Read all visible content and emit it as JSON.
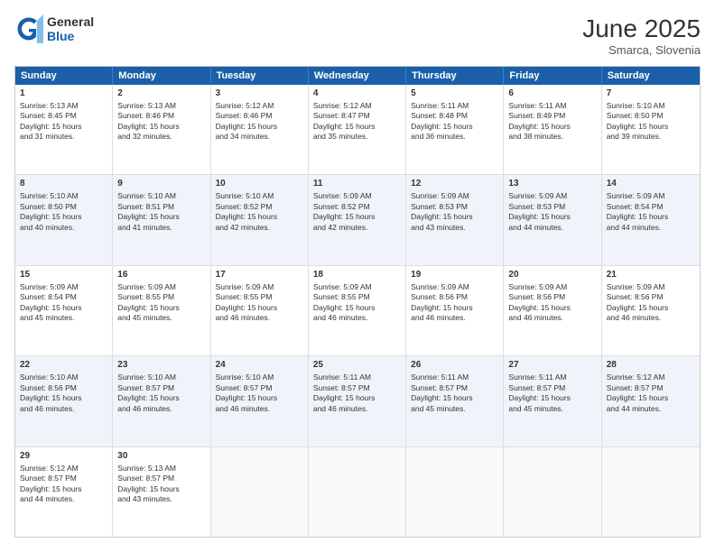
{
  "header": {
    "logo_general": "General",
    "logo_blue": "Blue",
    "month_title": "June 2025",
    "location": "Smarca, Slovenia"
  },
  "weekdays": [
    "Sunday",
    "Monday",
    "Tuesday",
    "Wednesday",
    "Thursday",
    "Friday",
    "Saturday"
  ],
  "rows": [
    {
      "alt": false,
      "cells": [
        {
          "day": "1",
          "lines": [
            "Sunrise: 5:13 AM",
            "Sunset: 8:45 PM",
            "Daylight: 15 hours",
            "and 31 minutes."
          ]
        },
        {
          "day": "2",
          "lines": [
            "Sunrise: 5:13 AM",
            "Sunset: 8:46 PM",
            "Daylight: 15 hours",
            "and 32 minutes."
          ]
        },
        {
          "day": "3",
          "lines": [
            "Sunrise: 5:12 AM",
            "Sunset: 8:46 PM",
            "Daylight: 15 hours",
            "and 34 minutes."
          ]
        },
        {
          "day": "4",
          "lines": [
            "Sunrise: 5:12 AM",
            "Sunset: 8:47 PM",
            "Daylight: 15 hours",
            "and 35 minutes."
          ]
        },
        {
          "day": "5",
          "lines": [
            "Sunrise: 5:11 AM",
            "Sunset: 8:48 PM",
            "Daylight: 15 hours",
            "and 36 minutes."
          ]
        },
        {
          "day": "6",
          "lines": [
            "Sunrise: 5:11 AM",
            "Sunset: 8:49 PM",
            "Daylight: 15 hours",
            "and 38 minutes."
          ]
        },
        {
          "day": "7",
          "lines": [
            "Sunrise: 5:10 AM",
            "Sunset: 8:50 PM",
            "Daylight: 15 hours",
            "and 39 minutes."
          ]
        }
      ]
    },
    {
      "alt": true,
      "cells": [
        {
          "day": "8",
          "lines": [
            "Sunrise: 5:10 AM",
            "Sunset: 8:50 PM",
            "Daylight: 15 hours",
            "and 40 minutes."
          ]
        },
        {
          "day": "9",
          "lines": [
            "Sunrise: 5:10 AM",
            "Sunset: 8:51 PM",
            "Daylight: 15 hours",
            "and 41 minutes."
          ]
        },
        {
          "day": "10",
          "lines": [
            "Sunrise: 5:10 AM",
            "Sunset: 8:52 PM",
            "Daylight: 15 hours",
            "and 42 minutes."
          ]
        },
        {
          "day": "11",
          "lines": [
            "Sunrise: 5:09 AM",
            "Sunset: 8:52 PM",
            "Daylight: 15 hours",
            "and 42 minutes."
          ]
        },
        {
          "day": "12",
          "lines": [
            "Sunrise: 5:09 AM",
            "Sunset: 8:53 PM",
            "Daylight: 15 hours",
            "and 43 minutes."
          ]
        },
        {
          "day": "13",
          "lines": [
            "Sunrise: 5:09 AM",
            "Sunset: 8:53 PM",
            "Daylight: 15 hours",
            "and 44 minutes."
          ]
        },
        {
          "day": "14",
          "lines": [
            "Sunrise: 5:09 AM",
            "Sunset: 8:54 PM",
            "Daylight: 15 hours",
            "and 44 minutes."
          ]
        }
      ]
    },
    {
      "alt": false,
      "cells": [
        {
          "day": "15",
          "lines": [
            "Sunrise: 5:09 AM",
            "Sunset: 8:54 PM",
            "Daylight: 15 hours",
            "and 45 minutes."
          ]
        },
        {
          "day": "16",
          "lines": [
            "Sunrise: 5:09 AM",
            "Sunset: 8:55 PM",
            "Daylight: 15 hours",
            "and 45 minutes."
          ]
        },
        {
          "day": "17",
          "lines": [
            "Sunrise: 5:09 AM",
            "Sunset: 8:55 PM",
            "Daylight: 15 hours",
            "and 46 minutes."
          ]
        },
        {
          "day": "18",
          "lines": [
            "Sunrise: 5:09 AM",
            "Sunset: 8:55 PM",
            "Daylight: 15 hours",
            "and 46 minutes."
          ]
        },
        {
          "day": "19",
          "lines": [
            "Sunrise: 5:09 AM",
            "Sunset: 8:56 PM",
            "Daylight: 15 hours",
            "and 46 minutes."
          ]
        },
        {
          "day": "20",
          "lines": [
            "Sunrise: 5:09 AM",
            "Sunset: 8:56 PM",
            "Daylight: 15 hours",
            "and 46 minutes."
          ]
        },
        {
          "day": "21",
          "lines": [
            "Sunrise: 5:09 AM",
            "Sunset: 8:56 PM",
            "Daylight: 15 hours",
            "and 46 minutes."
          ]
        }
      ]
    },
    {
      "alt": true,
      "cells": [
        {
          "day": "22",
          "lines": [
            "Sunrise: 5:10 AM",
            "Sunset: 8:56 PM",
            "Daylight: 15 hours",
            "and 46 minutes."
          ]
        },
        {
          "day": "23",
          "lines": [
            "Sunrise: 5:10 AM",
            "Sunset: 8:57 PM",
            "Daylight: 15 hours",
            "and 46 minutes."
          ]
        },
        {
          "day": "24",
          "lines": [
            "Sunrise: 5:10 AM",
            "Sunset: 8:57 PM",
            "Daylight: 15 hours",
            "and 46 minutes."
          ]
        },
        {
          "day": "25",
          "lines": [
            "Sunrise: 5:11 AM",
            "Sunset: 8:57 PM",
            "Daylight: 15 hours",
            "and 46 minutes."
          ]
        },
        {
          "day": "26",
          "lines": [
            "Sunrise: 5:11 AM",
            "Sunset: 8:57 PM",
            "Daylight: 15 hours",
            "and 45 minutes."
          ]
        },
        {
          "day": "27",
          "lines": [
            "Sunrise: 5:11 AM",
            "Sunset: 8:57 PM",
            "Daylight: 15 hours",
            "and 45 minutes."
          ]
        },
        {
          "day": "28",
          "lines": [
            "Sunrise: 5:12 AM",
            "Sunset: 8:57 PM",
            "Daylight: 15 hours",
            "and 44 minutes."
          ]
        }
      ]
    },
    {
      "alt": false,
      "cells": [
        {
          "day": "29",
          "lines": [
            "Sunrise: 5:12 AM",
            "Sunset: 8:57 PM",
            "Daylight: 15 hours",
            "and 44 minutes."
          ]
        },
        {
          "day": "30",
          "lines": [
            "Sunrise: 5:13 AM",
            "Sunset: 8:57 PM",
            "Daylight: 15 hours",
            "and 43 minutes."
          ]
        },
        {
          "day": "",
          "lines": []
        },
        {
          "day": "",
          "lines": []
        },
        {
          "day": "",
          "lines": []
        },
        {
          "day": "",
          "lines": []
        },
        {
          "day": "",
          "lines": []
        }
      ]
    }
  ]
}
